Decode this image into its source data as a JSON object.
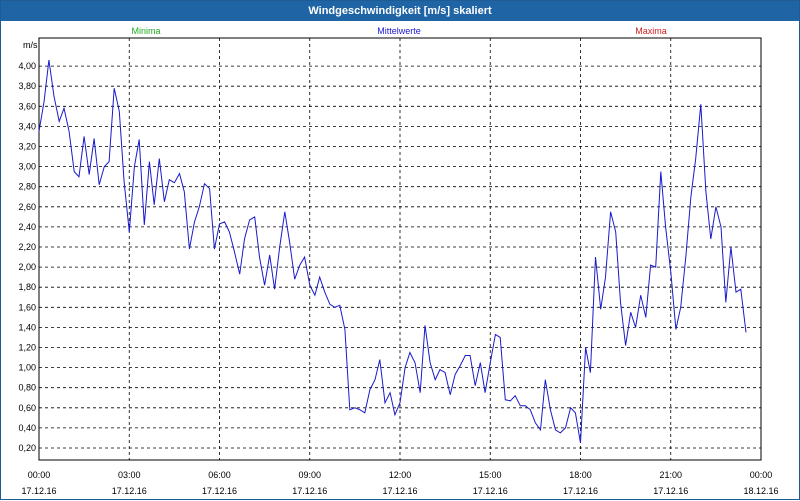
{
  "window": {
    "title": "Windgeschwindigkeit [m/s] skaliert"
  },
  "colors": {
    "minima": "#22aa22",
    "mittelwerte": "#1a1acc",
    "maxima": "#cc2222",
    "titlebar": "#1f64a4"
  },
  "chart_data": {
    "type": "line",
    "title": "Windgeschwindigkeit [m/s] skaliert",
    "ylabel": "m/s",
    "xlabel": "",
    "ylim": [
      0.1,
      4.2
    ],
    "grid": true,
    "legend": [
      {
        "name": "Minima",
        "color": "#22aa22"
      },
      {
        "name": "Mittelwerte",
        "color": "#1a1acc"
      },
      {
        "name": "Maxima",
        "color": "#cc2222"
      }
    ],
    "y_ticks": [
      "0,20",
      "0,40",
      "0,60",
      "0,80",
      "1,00",
      "1,20",
      "1,40",
      "1,60",
      "1,80",
      "2,00",
      "2,20",
      "2,40",
      "2,60",
      "2,80",
      "3,00",
      "3,20",
      "3,40",
      "3,60",
      "3,80",
      "4,00"
    ],
    "x_ticks": [
      {
        "time": "00:00",
        "date": "17.12.16"
      },
      {
        "time": "03:00",
        "date": "17.12.16"
      },
      {
        "time": "06:00",
        "date": "17.12.16"
      },
      {
        "time": "09:00",
        "date": "17.12.16"
      },
      {
        "time": "12:00",
        "date": "17.12.16"
      },
      {
        "time": "15:00",
        "date": "17.12.16"
      },
      {
        "time": "18:00",
        "date": "17.12.16"
      },
      {
        "time": "21:00",
        "date": "17.12.16"
      },
      {
        "time": "00:00",
        "date": "18.12.16"
      }
    ],
    "series": [
      {
        "name": "Mittelwerte",
        "color": "#1a1acc",
        "points": [
          [
            0.0,
            3.35
          ],
          [
            0.17,
            3.65
          ],
          [
            0.33,
            4.06
          ],
          [
            0.5,
            3.7
          ],
          [
            0.67,
            3.45
          ],
          [
            0.83,
            3.58
          ],
          [
            1.0,
            3.35
          ],
          [
            1.17,
            2.95
          ],
          [
            1.33,
            2.9
          ],
          [
            1.5,
            3.3
          ],
          [
            1.67,
            2.92
          ],
          [
            1.83,
            3.28
          ],
          [
            2.0,
            2.82
          ],
          [
            2.17,
            3.0
          ],
          [
            2.33,
            3.05
          ],
          [
            2.5,
            3.78
          ],
          [
            2.67,
            3.55
          ],
          [
            2.83,
            2.85
          ],
          [
            3.0,
            2.35
          ],
          [
            3.17,
            3.0
          ],
          [
            3.33,
            3.27
          ],
          [
            3.5,
            2.42
          ],
          [
            3.67,
            3.05
          ],
          [
            3.83,
            2.62
          ],
          [
            4.0,
            3.08
          ],
          [
            4.17,
            2.65
          ],
          [
            4.33,
            2.87
          ],
          [
            4.5,
            2.84
          ],
          [
            4.67,
            2.93
          ],
          [
            4.83,
            2.75
          ],
          [
            5.0,
            2.18
          ],
          [
            5.17,
            2.45
          ],
          [
            5.33,
            2.6
          ],
          [
            5.5,
            2.83
          ],
          [
            5.67,
            2.78
          ],
          [
            5.83,
            2.18
          ],
          [
            6.0,
            2.43
          ],
          [
            6.17,
            2.45
          ],
          [
            6.33,
            2.35
          ],
          [
            6.5,
            2.15
          ],
          [
            6.67,
            1.93
          ],
          [
            6.83,
            2.28
          ],
          [
            7.0,
            2.47
          ],
          [
            7.17,
            2.5
          ],
          [
            7.33,
            2.1
          ],
          [
            7.5,
            1.82
          ],
          [
            7.67,
            2.12
          ],
          [
            7.83,
            1.78
          ],
          [
            8.0,
            2.2
          ],
          [
            8.17,
            2.55
          ],
          [
            8.33,
            2.25
          ],
          [
            8.5,
            1.88
          ],
          [
            8.67,
            2.02
          ],
          [
            8.83,
            2.1
          ],
          [
            9.0,
            1.82
          ],
          [
            9.17,
            1.72
          ],
          [
            9.33,
            1.9
          ],
          [
            9.5,
            1.75
          ],
          [
            9.67,
            1.63
          ],
          [
            9.83,
            1.6
          ],
          [
            10.0,
            1.62
          ],
          [
            10.17,
            1.38
          ],
          [
            10.33,
            0.58
          ],
          [
            10.5,
            0.6
          ],
          [
            10.67,
            0.58
          ],
          [
            10.83,
            0.55
          ],
          [
            11.0,
            0.78
          ],
          [
            11.17,
            0.88
          ],
          [
            11.33,
            1.08
          ],
          [
            11.5,
            0.65
          ],
          [
            11.67,
            0.75
          ],
          [
            11.83,
            0.53
          ],
          [
            12.0,
            0.65
          ],
          [
            12.17,
            1.0
          ],
          [
            12.33,
            1.15
          ],
          [
            12.5,
            1.05
          ],
          [
            12.67,
            0.75
          ],
          [
            12.83,
            1.42
          ],
          [
            13.0,
            1.05
          ],
          [
            13.17,
            0.88
          ],
          [
            13.33,
            0.98
          ],
          [
            13.5,
            0.95
          ],
          [
            13.67,
            0.73
          ],
          [
            13.83,
            0.93
          ],
          [
            14.0,
            1.02
          ],
          [
            14.17,
            1.12
          ],
          [
            14.33,
            1.12
          ],
          [
            14.5,
            0.82
          ],
          [
            14.67,
            1.05
          ],
          [
            14.83,
            0.75
          ],
          [
            15.0,
            1.05
          ],
          [
            15.17,
            1.33
          ],
          [
            15.33,
            1.3
          ],
          [
            15.5,
            0.68
          ],
          [
            15.67,
            0.67
          ],
          [
            15.83,
            0.72
          ],
          [
            16.0,
            0.62
          ],
          [
            16.17,
            0.62
          ],
          [
            16.33,
            0.58
          ],
          [
            16.5,
            0.45
          ],
          [
            16.67,
            0.38
          ],
          [
            16.83,
            0.88
          ],
          [
            17.0,
            0.58
          ],
          [
            17.17,
            0.38
          ],
          [
            17.33,
            0.35
          ],
          [
            17.5,
            0.4
          ],
          [
            17.67,
            0.6
          ],
          [
            17.83,
            0.55
          ],
          [
            18.0,
            0.25
          ],
          [
            18.17,
            1.2
          ],
          [
            18.33,
            0.95
          ],
          [
            18.5,
            2.1
          ],
          [
            18.67,
            1.58
          ],
          [
            18.83,
            1.9
          ],
          [
            19.0,
            2.55
          ],
          [
            19.17,
            2.35
          ],
          [
            19.33,
            1.65
          ],
          [
            19.5,
            1.22
          ],
          [
            19.67,
            1.55
          ],
          [
            19.83,
            1.4
          ],
          [
            20.0,
            1.72
          ],
          [
            20.17,
            1.5
          ],
          [
            20.33,
            2.02
          ],
          [
            20.5,
            2.0
          ],
          [
            20.67,
            2.95
          ],
          [
            20.83,
            2.4
          ],
          [
            21.0,
            1.95
          ],
          [
            21.17,
            1.38
          ],
          [
            21.33,
            1.6
          ],
          [
            21.5,
            2.1
          ],
          [
            21.67,
            2.7
          ],
          [
            21.83,
            3.08
          ],
          [
            22.0,
            3.62
          ],
          [
            22.17,
            2.75
          ],
          [
            22.33,
            2.28
          ],
          [
            22.5,
            2.6
          ],
          [
            22.67,
            2.4
          ],
          [
            22.83,
            1.65
          ],
          [
            23.0,
            2.2
          ],
          [
            23.17,
            1.75
          ],
          [
            23.33,
            1.78
          ],
          [
            23.5,
            1.35
          ]
        ]
      }
    ]
  }
}
